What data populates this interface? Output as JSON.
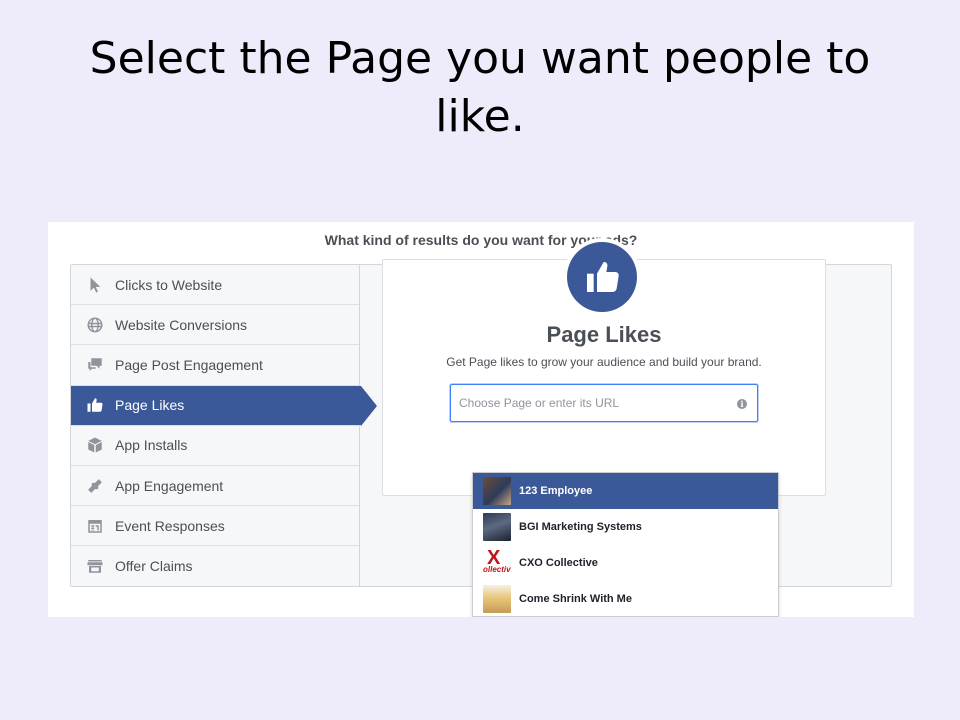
{
  "slide": {
    "title": "Select the Page you want people to like."
  },
  "screen": {
    "question": "What kind of results do you want for your ads?",
    "menu": [
      {
        "label": "Clicks to Website",
        "icon": "cursor-icon"
      },
      {
        "label": "Website Conversions",
        "icon": "globe-icon"
      },
      {
        "label": "Page Post Engagement",
        "icon": "chat-bubbles-icon"
      },
      {
        "label": "Page Likes",
        "icon": "thumbs-up-icon",
        "selected": true
      },
      {
        "label": "App Installs",
        "icon": "box-icon"
      },
      {
        "label": "App Engagement",
        "icon": "gamepad-icon"
      },
      {
        "label": "Event Responses",
        "icon": "calendar-icon"
      },
      {
        "label": "Offer Claims",
        "icon": "storefront-icon"
      }
    ],
    "objective": {
      "title": "Page Likes",
      "description": "Get Page likes to grow your audience and build your brand.",
      "icon": "thumbs-up-icon"
    },
    "chooser": {
      "placeholder": "Choose Page or enter its URL",
      "value": ""
    },
    "pages": [
      {
        "name": "123 Employee",
        "highlighted": true
      },
      {
        "name": "BGI Marketing Systems"
      },
      {
        "name": "CXO Collective",
        "logo_text": "X",
        "logo_sub": "ollective"
      },
      {
        "name": "Come Shrink With Me"
      }
    ]
  },
  "colors": {
    "slide_bg": "#eeebfb",
    "accent": "#3b5998",
    "focus_border": "#4080ff"
  }
}
